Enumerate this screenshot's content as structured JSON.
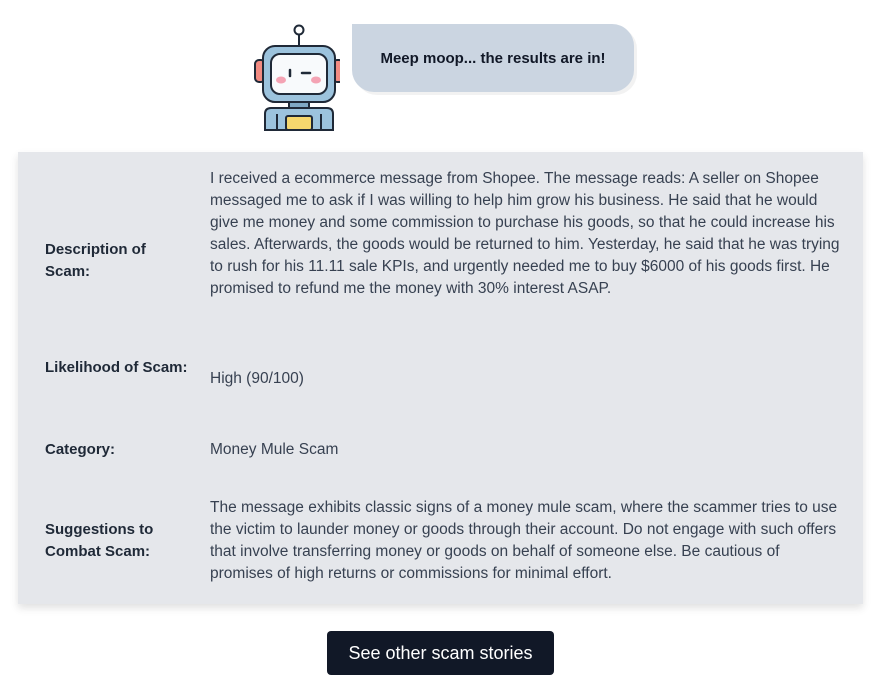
{
  "header": {
    "robot_icon": "robot-mascot-icon",
    "bubble_text": "Meep moop... the results are in!"
  },
  "results": {
    "description": {
      "label": "Description of Scam:",
      "value": "I received a ecommerce message from Shopee. The message reads: A seller on Shopee messaged me to ask if I was willing to help him grow his business. He said that he would give me money and some commission to purchase his goods, so that he could increase his sales. Afterwards, the goods would be returned to him. Yesterday, he said that he was trying to rush for his 11.11 sale KPIs, and urgently needed me to buy $6000 of his goods first. He promised to refund me the money with 30% interest ASAP."
    },
    "likelihood": {
      "label": "Likelihood of Scam:",
      "value": "High (90/100)"
    },
    "category": {
      "label": "Category:",
      "value": "Money Mule Scam"
    },
    "suggestions": {
      "label": "Suggestions to Combat Scam:",
      "value": "The message exhibits classic signs of a money mule scam, where the scammer tries to use the victim to launder money or goods through their account. Do not engage with such offers that involve transferring money or goods on behalf of someone else. Be cautious of promises of high returns or commissions for minimal effort."
    }
  },
  "cta": {
    "label": "See other scam stories"
  },
  "colors": {
    "bubble": "#cbd5e1",
    "card": "#e5e7eb",
    "button": "#111827"
  }
}
